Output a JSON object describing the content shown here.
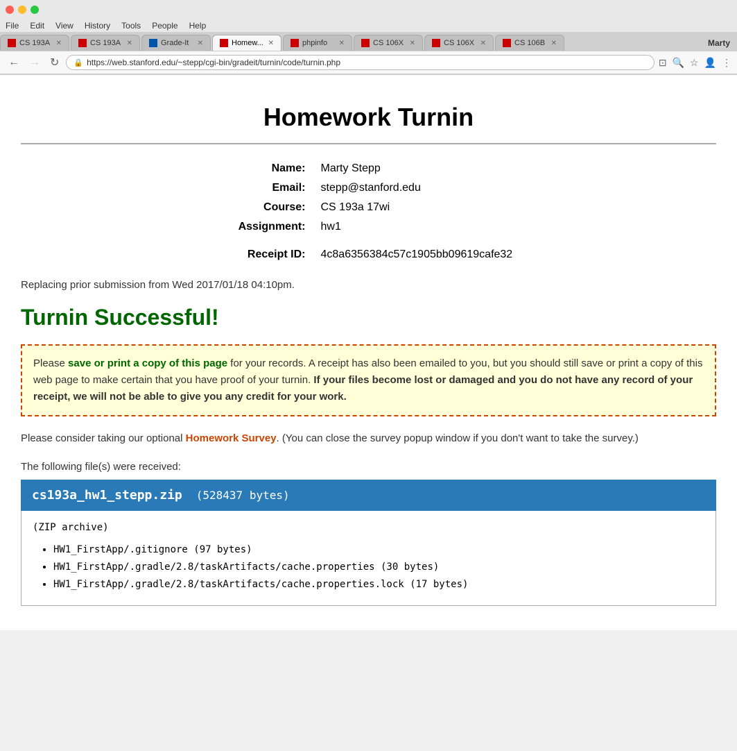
{
  "browser": {
    "window_controls": [
      "close",
      "minimize",
      "maximize"
    ],
    "menu_items": [
      "File",
      "Edit",
      "View",
      "History",
      "Tools",
      "People",
      "Help"
    ],
    "tabs": [
      {
        "label": "CS 193A",
        "favicon_color": "red",
        "active": false
      },
      {
        "label": "CS 193A",
        "favicon_color": "red",
        "active": false
      },
      {
        "label": "Grade-It",
        "favicon_color": "blue",
        "active": false
      },
      {
        "label": "Homew...",
        "favicon_color": "red",
        "active": true
      },
      {
        "label": "phpinfo",
        "favicon_color": "red",
        "active": false
      },
      {
        "label": "CS 106X",
        "favicon_color": "red",
        "active": false
      },
      {
        "label": "CS 106X",
        "favicon_color": "red",
        "active": false
      },
      {
        "label": "CS 106B",
        "favicon_color": "red",
        "active": false
      }
    ],
    "user": "Marty",
    "url": "https://web.stanford.edu/~stepp/cgi-bin/gradeit/turnin/code/turnin.php",
    "nav": {
      "back_disabled": false,
      "forward_disabled": true
    }
  },
  "page": {
    "title": "Homework Turnin",
    "fields": {
      "name_label": "Name:",
      "name_value": "Marty Stepp",
      "email_label": "Email:",
      "email_value": "stepp@stanford.edu",
      "course_label": "Course:",
      "course_value": "CS 193a 17wi",
      "assignment_label": "Assignment:",
      "assignment_value": "hw1",
      "receipt_label": "Receipt ID:",
      "receipt_value": "4c8a6356384c57c1905bb09619cafe32"
    },
    "replacing_text": "Replacing prior submission from Wed 2017/01/18 04:10pm.",
    "success_title": "Turnin Successful!",
    "warning": {
      "part1": "Please ",
      "save_link_text": "save or print a copy of this page",
      "part2": " for your records. A receipt has also been emailed to you, but you should still save or print a copy of this web page to make certain that you have proof of your turnin. ",
      "bold_part": "If your files become lost or damaged and you do not have any record of your receipt, we will not be able to give you any credit for your work."
    },
    "survey": {
      "prefix": "Please consider taking our optional ",
      "link_text": "Homework Survey",
      "suffix": ". (You can close the survey popup window if you don't want to take the survey.)"
    },
    "files_heading": "The following file(s) were received:",
    "file": {
      "name": "cs193a_hw1_stepp.zip",
      "size": "(528437 bytes)",
      "type": "(ZIP archive)",
      "entries": [
        "HW1_FirstApp/.gitignore (97 bytes)",
        "HW1_FirstApp/.gradle/2.8/taskArtifacts/cache.properties (30 bytes)",
        "HW1_FirstApp/.gradle/2.8/taskArtifacts/cache.properties.lock (17 bytes)"
      ]
    }
  }
}
